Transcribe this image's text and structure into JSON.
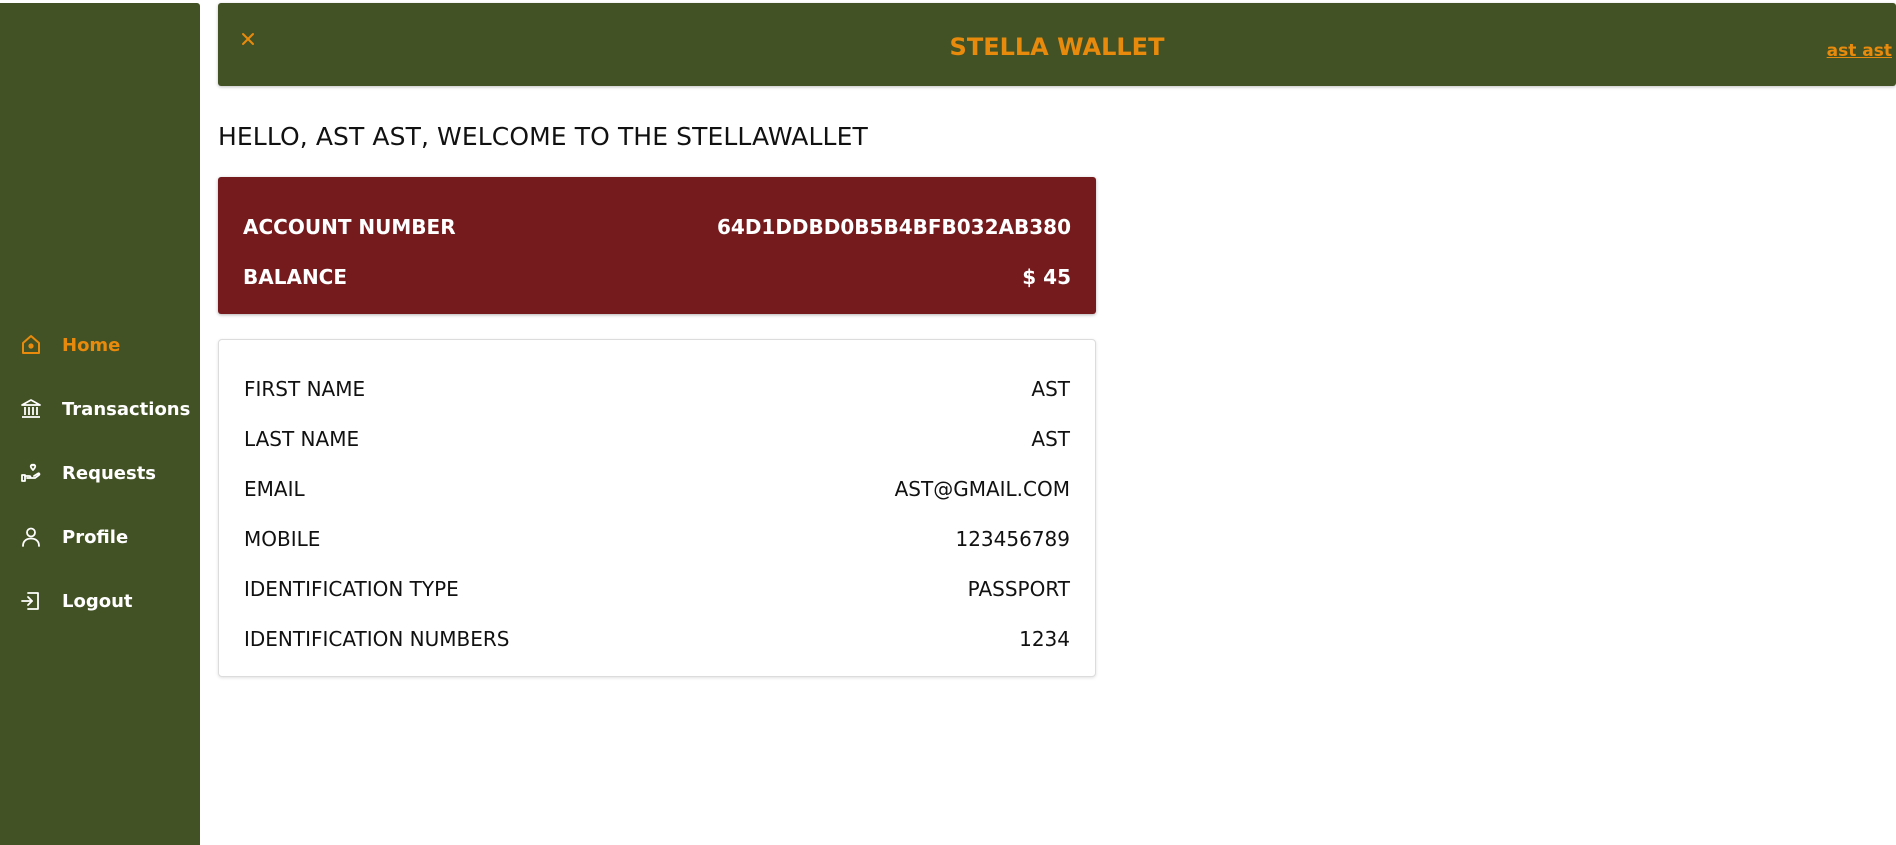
{
  "sidebar": {
    "items": [
      {
        "label": "Home",
        "icon": "home-icon",
        "active": true
      },
      {
        "label": "Transactions",
        "icon": "bank-icon",
        "active": false
      },
      {
        "label": "Requests",
        "icon": "hand-heart-icon",
        "active": false
      },
      {
        "label": "Profile",
        "icon": "user-icon",
        "active": false
      },
      {
        "label": "Logout",
        "icon": "logout-icon",
        "active": false
      }
    ]
  },
  "header": {
    "close_icon": "close-icon",
    "title": "STELLA WALLET",
    "user_link": "ast ast"
  },
  "welcome": "HELLO, AST AST, WELCOME TO THE STELLAWALLET",
  "account": {
    "number_label": "ACCOUNT NUMBER",
    "number_value": "64D1DDBD0B5B4BFB032AB380",
    "balance_label": "BALANCE",
    "balance_value": "$ 45"
  },
  "profile": {
    "rows": [
      {
        "label": "FIRST NAME",
        "value": "AST"
      },
      {
        "label": "LAST NAME",
        "value": "AST"
      },
      {
        "label": "EMAIL",
        "value": "AST@GMAIL.COM"
      },
      {
        "label": "MOBILE",
        "value": "123456789"
      },
      {
        "label": "IDENTIFICATION TYPE",
        "value": "PASSPORT"
      },
      {
        "label": "IDENTIFICATION NUMBERS",
        "value": "1234"
      }
    ]
  },
  "colors": {
    "brand_green": "#425224",
    "accent_orange": "#e88a0c",
    "account_red": "#751b1e"
  }
}
